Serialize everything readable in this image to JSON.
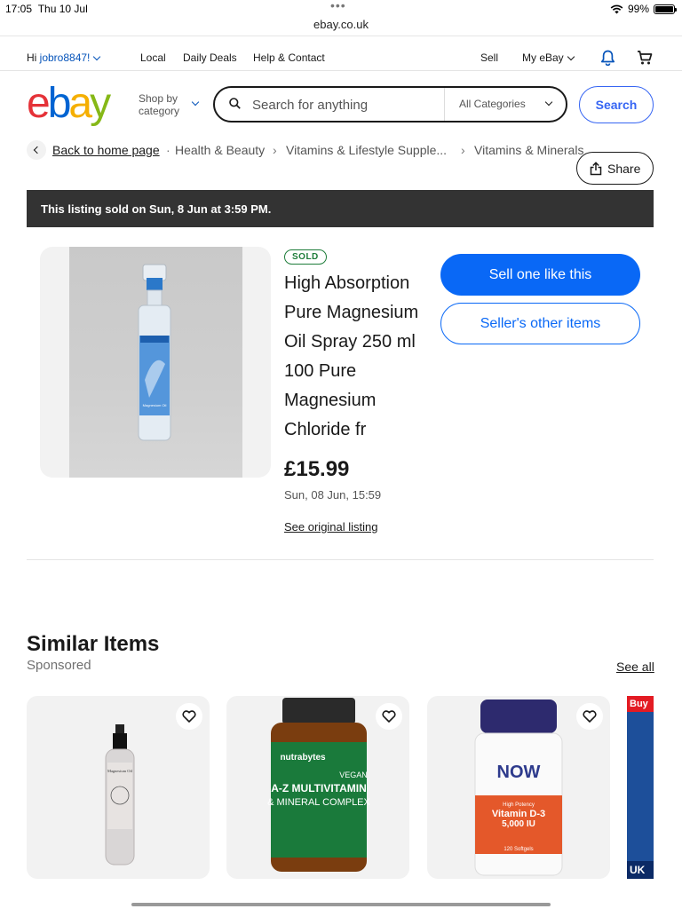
{
  "status_bar": {
    "time": "17:05",
    "date": "Thu 10 Jul",
    "battery": "99%",
    "battery_level": 0.99
  },
  "browser": {
    "url": "ebay.co.uk"
  },
  "top_nav": {
    "greeting": "Hi ",
    "username": "jobro8847!",
    "links": [
      "Local",
      "Daily Deals",
      "Help & Contact"
    ],
    "sell": "Sell",
    "my_ebay": "My eBay"
  },
  "header": {
    "logo": {
      "e": "e",
      "b": "b",
      "a": "a",
      "y": "y"
    },
    "shop_by_line1": "Shop by",
    "shop_by_line2": "category",
    "search_placeholder": "Search for anything",
    "category": "All Categories",
    "search_button": "Search"
  },
  "breadcrumbs": [
    "Back to home page",
    "Health & Beauty",
    "Vitamins & Lifestyle Supple...",
    "Vitamins & Minerals"
  ],
  "share_label": "Share",
  "sold_banner": "This listing sold on Sun, 8 Jun at 3:59 PM.",
  "listing": {
    "badge": "SOLD",
    "title": "High Absorption Pure Magnesium Oil Spray 250 ml 100 Pure Magnesium Chloride fr",
    "price": "£15.99",
    "sold_date": "Sun, 08 Jun, 15:59",
    "original_link": "See original listing",
    "image_label": "Magnesium Oil"
  },
  "actions": {
    "sell_one": "Sell one like this",
    "sellers_other": "Seller's other items"
  },
  "similar": {
    "title": "Similar Items",
    "subtitle": "Sponsored",
    "see_all": "See all",
    "cards": [
      {
        "label": "Magnesium Oil"
      },
      {
        "brand": "nutrabytes",
        "line1": "VEGAN",
        "line2": "A-Z MULTIVITAMIN",
        "line3": "& MINERAL COMPLEX"
      },
      {
        "brand": "NOW",
        "line1": "High Potency",
        "line2": "Vitamin D-3",
        "line3": "5,000 IU",
        "line4": "120 Softgels"
      }
    ],
    "partial_card": {
      "top": "Buy",
      "bottom": "UK"
    }
  },
  "colors": {
    "accent": "#3665f3",
    "primary_button": "#0968f6",
    "sold_green": "#1e7d3a",
    "banner": "#333333"
  }
}
